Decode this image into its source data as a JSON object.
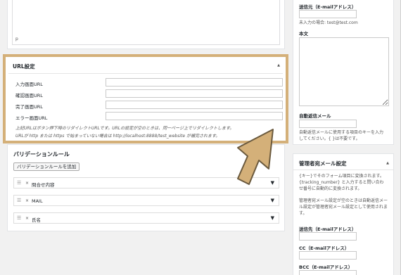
{
  "editor": {
    "path": "p"
  },
  "url_settings": {
    "title": "URL設定",
    "toggle_icon": "▲",
    "rows": [
      {
        "label": "入力画面URL",
        "value": ""
      },
      {
        "label": "確認画面URL",
        "value": ""
      },
      {
        "label": "完了画面URL",
        "value": ""
      },
      {
        "label": "エラー画面URL",
        "value": ""
      }
    ],
    "note1": "上記URLはボタン押下時のリダイレクトURLです。URLの設定が空のときは、同一ページ上でリダイレクトします。",
    "note2": "URLが http または https で始まっていない場合は http://localhost:8888/test_website が補完されます。"
  },
  "validation": {
    "title": "バリデーションルール",
    "add_button": "バリデーションルールを追加",
    "rules": [
      {
        "handle": "☰",
        "remove": "×",
        "label": "問合せ内容",
        "arrow": "▼"
      },
      {
        "handle": "☰",
        "remove": "×",
        "label": "MAIL",
        "arrow": "▼"
      },
      {
        "handle": "☰",
        "remove": "×",
        "label": "氏名",
        "arrow": "▼"
      }
    ]
  },
  "sidebar_top": {
    "to_label": "送信元（E-mailアドレス）",
    "to_help": "未入力の場合: test@test.com",
    "body_label": "本文",
    "auto_reply_label": "自動返信メール",
    "auto_reply_help": "自動返信メールに使用する項目のキーを入力してください。{ }は不要です。"
  },
  "sidebar_admin": {
    "title": "管理者宛メール設定",
    "toggle_icon": "▲",
    "help1": "{キー}でそのフォーム項目に変換されます。 {tracking_number} と入力すると問い合わせ番号に自動的に変換されます。",
    "help2": "管理者宛メール設定が空のときは自動返信メール設定が管理者宛メール設定として使用されます。",
    "from_label": "送信先（E-mailアドレス）",
    "cc_label": "CC（E-mailアドレス）",
    "bcc_label": "BCC（E-mailアドレス）"
  },
  "colors": {
    "highlight": "#d4b079",
    "pointer": "#d4b079"
  }
}
